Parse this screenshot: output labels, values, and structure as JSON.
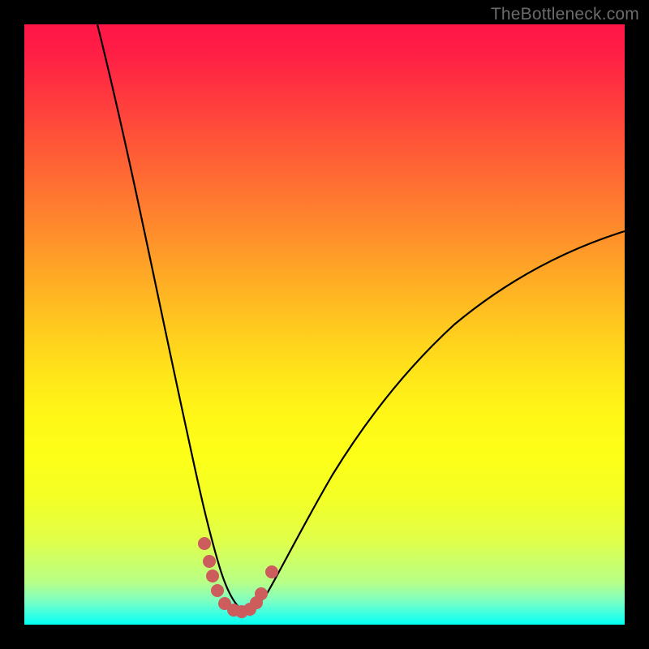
{
  "watermark": "TheBottleneck.com",
  "colors": {
    "curve_stroke": "#000000",
    "marker_fill": "#cd5c5c",
    "background": "#000000"
  },
  "chart_data": {
    "type": "line",
    "title": "",
    "xlabel": "",
    "ylabel": "",
    "xlim": [
      0,
      100
    ],
    "ylim": [
      0,
      100
    ],
    "series": [
      {
        "name": "left-curve",
        "x": [
          12,
          16,
          20,
          22,
          24,
          26,
          27,
          28,
          29,
          30,
          31,
          32,
          33,
          34
        ],
        "y": [
          100,
          84,
          65,
          55,
          44,
          33,
          27,
          21,
          16,
          12,
          8,
          5,
          3,
          2
        ]
      },
      {
        "name": "right-curve",
        "x": [
          34,
          36,
          38,
          40,
          42,
          46,
          50,
          55,
          60,
          66,
          72,
          80,
          88,
          96,
          100
        ],
        "y": [
          1,
          2,
          4,
          7,
          10,
          16,
          22,
          29,
          35,
          41,
          47,
          53,
          59,
          63,
          65
        ]
      }
    ],
    "markers": [
      {
        "x": 29.5,
        "y": 13
      },
      {
        "x": 30.3,
        "y": 10
      },
      {
        "x": 30.8,
        "y": 7.5
      },
      {
        "x": 31.7,
        "y": 5
      },
      {
        "x": 32.8,
        "y": 3
      },
      {
        "x": 34.2,
        "y": 2
      },
      {
        "x": 35.5,
        "y": 2
      },
      {
        "x": 36.8,
        "y": 2.5
      },
      {
        "x": 37.8,
        "y": 3.5
      },
      {
        "x": 38.6,
        "y": 5
      },
      {
        "x": 40.5,
        "y": 8.5
      }
    ],
    "gradient_stops": [
      {
        "pos": 0,
        "color": "#ff1648"
      },
      {
        "pos": 50,
        "color": "#ffc81f"
      },
      {
        "pos": 72,
        "color": "#fdff18"
      },
      {
        "pos": 100,
        "color": "#00fff2"
      }
    ]
  }
}
